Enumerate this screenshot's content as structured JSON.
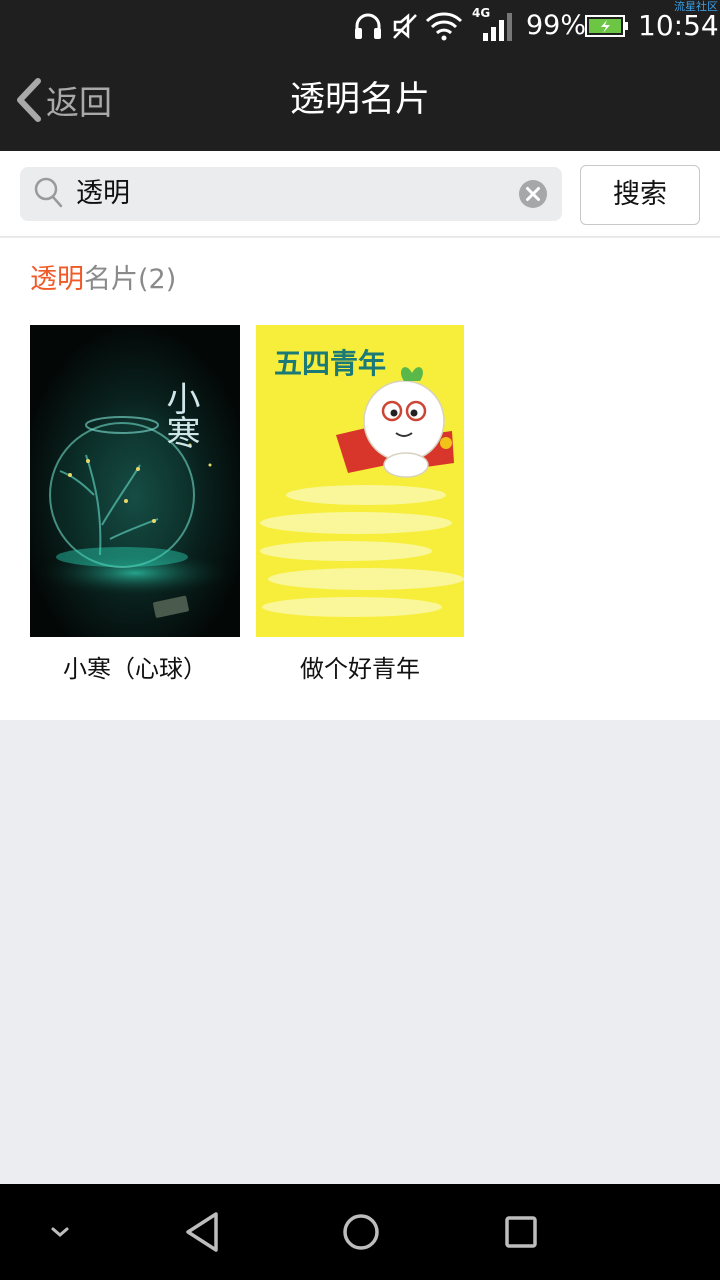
{
  "status_bar": {
    "network": "4G",
    "battery": "99%",
    "time": "10:54",
    "watermark": "流星社区",
    "icons": [
      "headphones-icon",
      "mute-icon",
      "wifi-icon",
      "signal-icon",
      "battery-charging-icon"
    ]
  },
  "header": {
    "back_label": "返回",
    "title": "透明名片"
  },
  "search": {
    "query": "透明",
    "button_label": "搜索"
  },
  "results": {
    "highlight": "透明",
    "rest": "名片(2)",
    "items": [
      {
        "caption": "小寒（心球）",
        "image_text": "小寒"
      },
      {
        "caption": "做个好青年",
        "image_text": "五四青年"
      }
    ]
  },
  "colors": {
    "bar": "#1f1f1f",
    "accent": "#f05a28",
    "background": "#ebedf0"
  }
}
